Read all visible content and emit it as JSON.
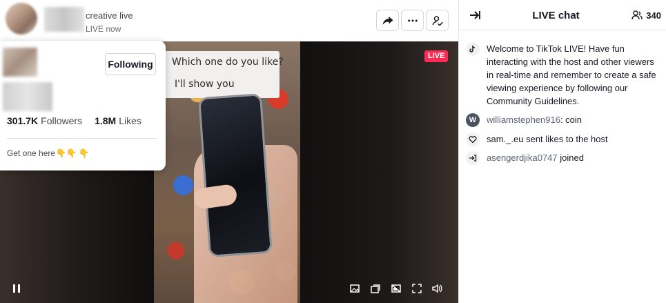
{
  "header": {
    "host_title": "creative live",
    "host_status": "LIVE now",
    "share_icon": "share-icon",
    "more_icon": "more-icon",
    "follow_icon": "user-check-icon"
  },
  "video": {
    "sign_line1": "Which one do you like?",
    "sign_line2": "I'll show you",
    "live_badge": "LIVE",
    "live_color": "#fe2c55"
  },
  "controls": [
    "pause-icon",
    "picture-icon",
    "mini-player-icon",
    "screen-off-icon",
    "fullscreen-icon",
    "volume-icon"
  ],
  "profile_popover": {
    "following_label": "Following",
    "followers_value": "301.7K",
    "followers_label": "Followers",
    "likes_value": "1.8M",
    "likes_label": "Likes",
    "bio_text": "Get one here"
  },
  "chat": {
    "title": "LIVE chat",
    "viewer_count": "340",
    "messages": [
      {
        "type": "system",
        "text": "Welcome to TikTok LIVE! Have fun interacting with the host and other viewers in real-time and remember to create a safe viewing experience by following our Community Guidelines."
      },
      {
        "type": "comment",
        "avatar_letter": "W",
        "user": "williamstephen916",
        "text": ": coin"
      },
      {
        "type": "like",
        "user": "sam._.eu",
        "text": " sent likes to the host"
      },
      {
        "type": "join",
        "user": "asengerdjika0747",
        "text": " joined"
      }
    ]
  }
}
